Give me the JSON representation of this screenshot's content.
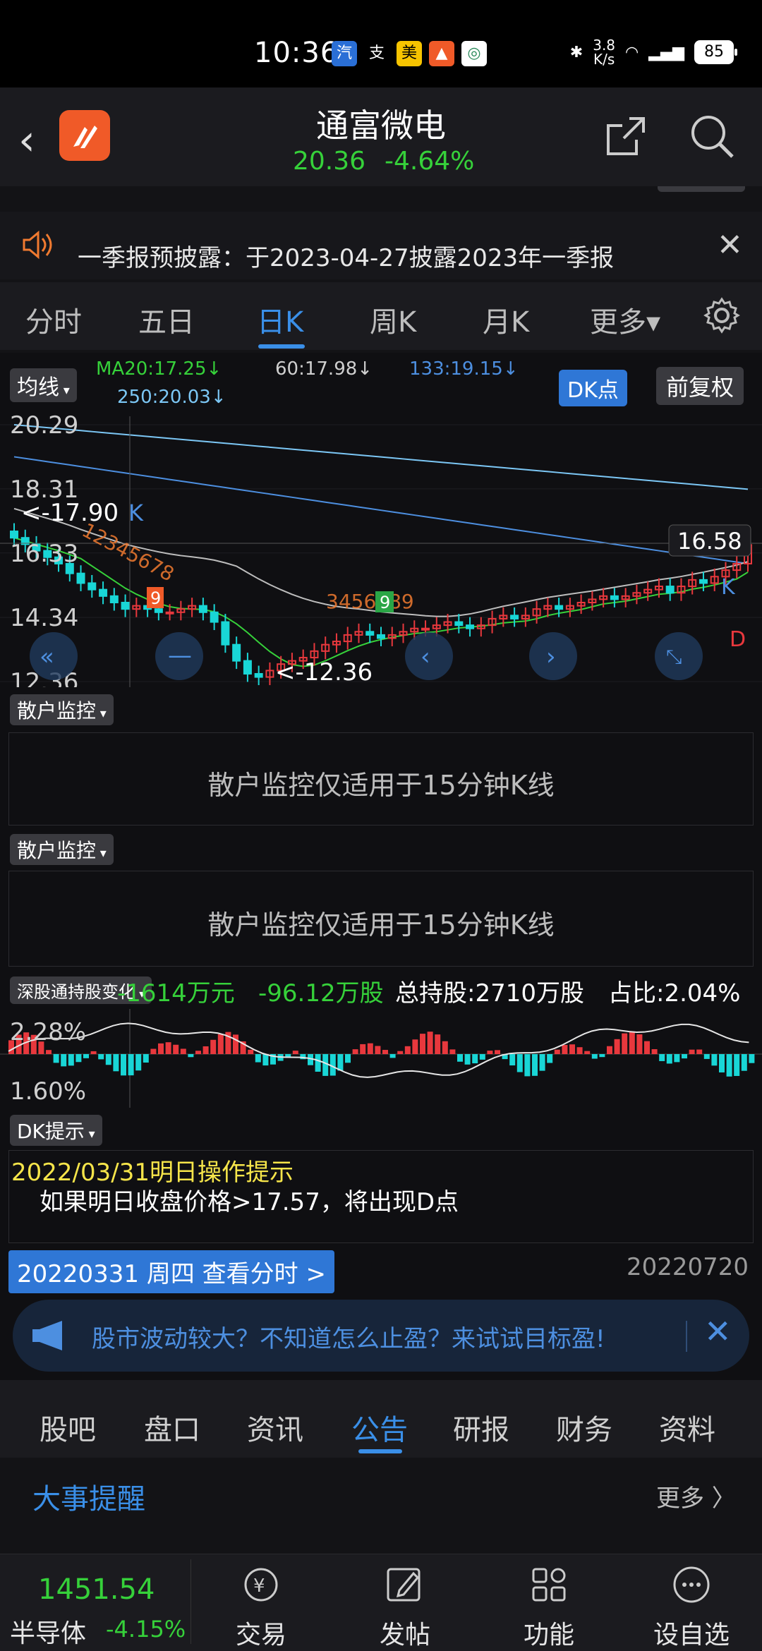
{
  "status": {
    "time": "10:36",
    "net_speed": "3.8\nK/s",
    "battery": "85"
  },
  "header": {
    "name": "通富微电",
    "price": "20.36",
    "change": "-4.64%"
  },
  "notice": {
    "text": "一季报预披露：于2023-04-27披露2023年一季报"
  },
  "ktabs": [
    "分时",
    "五日",
    "日K",
    "周K",
    "月K",
    "更多▾"
  ],
  "chart": {
    "ma_label": "均线",
    "ma20": "MA20:17.25↓",
    "ma60": "60:17.98↓",
    "ma133": "133:19.15↓",
    "ma250": "250:20.03↓",
    "dk_btn": "DK点",
    "fq_btn": "前复权",
    "y_ticks": [
      "20.29",
      "18.31",
      "16.33",
      "14.34",
      "12.36"
    ],
    "high_label": "<-17.90",
    "low_label": "<-12.36",
    "current_price": "16.58",
    "marker_k": "K",
    "marker_d": "D",
    "seq_top": "12345678",
    "seq_bottom": "3456789",
    "badge_9": "9"
  },
  "chart_data": {
    "type": "candlestick",
    "title": "通富微电 日K",
    "ylim": [
      12.36,
      20.29
    ],
    "y_ticks": [
      20.29,
      18.31,
      16.33,
      14.34,
      12.36
    ],
    "ma": [
      {
        "name": "MA20",
        "value": 17.25
      },
      {
        "name": "MA60",
        "value": 17.98
      },
      {
        "name": "MA133",
        "value": 19.15
      },
      {
        "name": "MA250",
        "value": 20.03
      }
    ],
    "period_high": 17.9,
    "period_low": 12.36,
    "last_price": 16.58,
    "close_series": [
      16.8,
      16.6,
      16.4,
      16.2,
      16.0,
      15.7,
      15.4,
      15.2,
      15.0,
      14.8,
      14.6,
      14.7,
      14.6,
      14.5,
      14.5,
      14.6,
      14.7,
      14.5,
      14.2,
      13.5,
      13.0,
      12.6,
      12.5,
      12.7,
      12.9,
      13.0,
      13.1,
      13.3,
      13.5,
      13.6,
      13.8,
      13.9,
      13.8,
      13.7,
      13.8,
      13.9,
      14.0,
      14.0,
      14.1,
      14.2,
      14.1,
      14.0,
      14.1,
      14.3,
      14.4,
      14.3,
      14.4,
      14.6,
      14.7,
      14.6,
      14.7,
      14.8,
      14.9,
      15.0,
      14.9,
      15.0,
      15.1,
      15.2,
      15.3,
      15.1,
      15.3,
      15.5,
      15.4,
      15.6,
      15.8,
      16.0,
      16.58
    ]
  },
  "sections": {
    "retail_label": "散户监控",
    "retail_msg": "散户监控仅适用于15分钟K线",
    "sz_label": "深股通持股变化",
    "sz_change_amt": "-1614万元",
    "sz_change_shares": "-96.12万股",
    "sz_total": "总持股:2710万股",
    "sz_ratio": "占比:2.04%",
    "sz_y_top": "2.28%",
    "sz_y_bottom": "1.60%",
    "dk_label": "DK提示",
    "dk_date": "2022/03/31明日操作提示",
    "dk_tip": "如果明日收盘价格>17.57，将出现D点",
    "date_btn": "20220331 周四 查看分时 >",
    "date_right": "20220720"
  },
  "ad": {
    "text": "股市波动较大？不知道怎么止盈？来试试目标盈!"
  },
  "btabs": [
    "股吧",
    "盘口",
    "资讯",
    "公告",
    "研报",
    "财务",
    "资料"
  ],
  "events": {
    "title": "大事提醒",
    "more": "更多 〉"
  },
  "bottom": {
    "index_value": "1451.54",
    "index_name": "半导体",
    "index_change": "-4.15%",
    "nav": [
      "交易",
      "发帖",
      "功能",
      "设自选"
    ]
  },
  "colors": {
    "up": "#e8383d",
    "down": "#36d13a",
    "accent": "#3a8fe8"
  }
}
